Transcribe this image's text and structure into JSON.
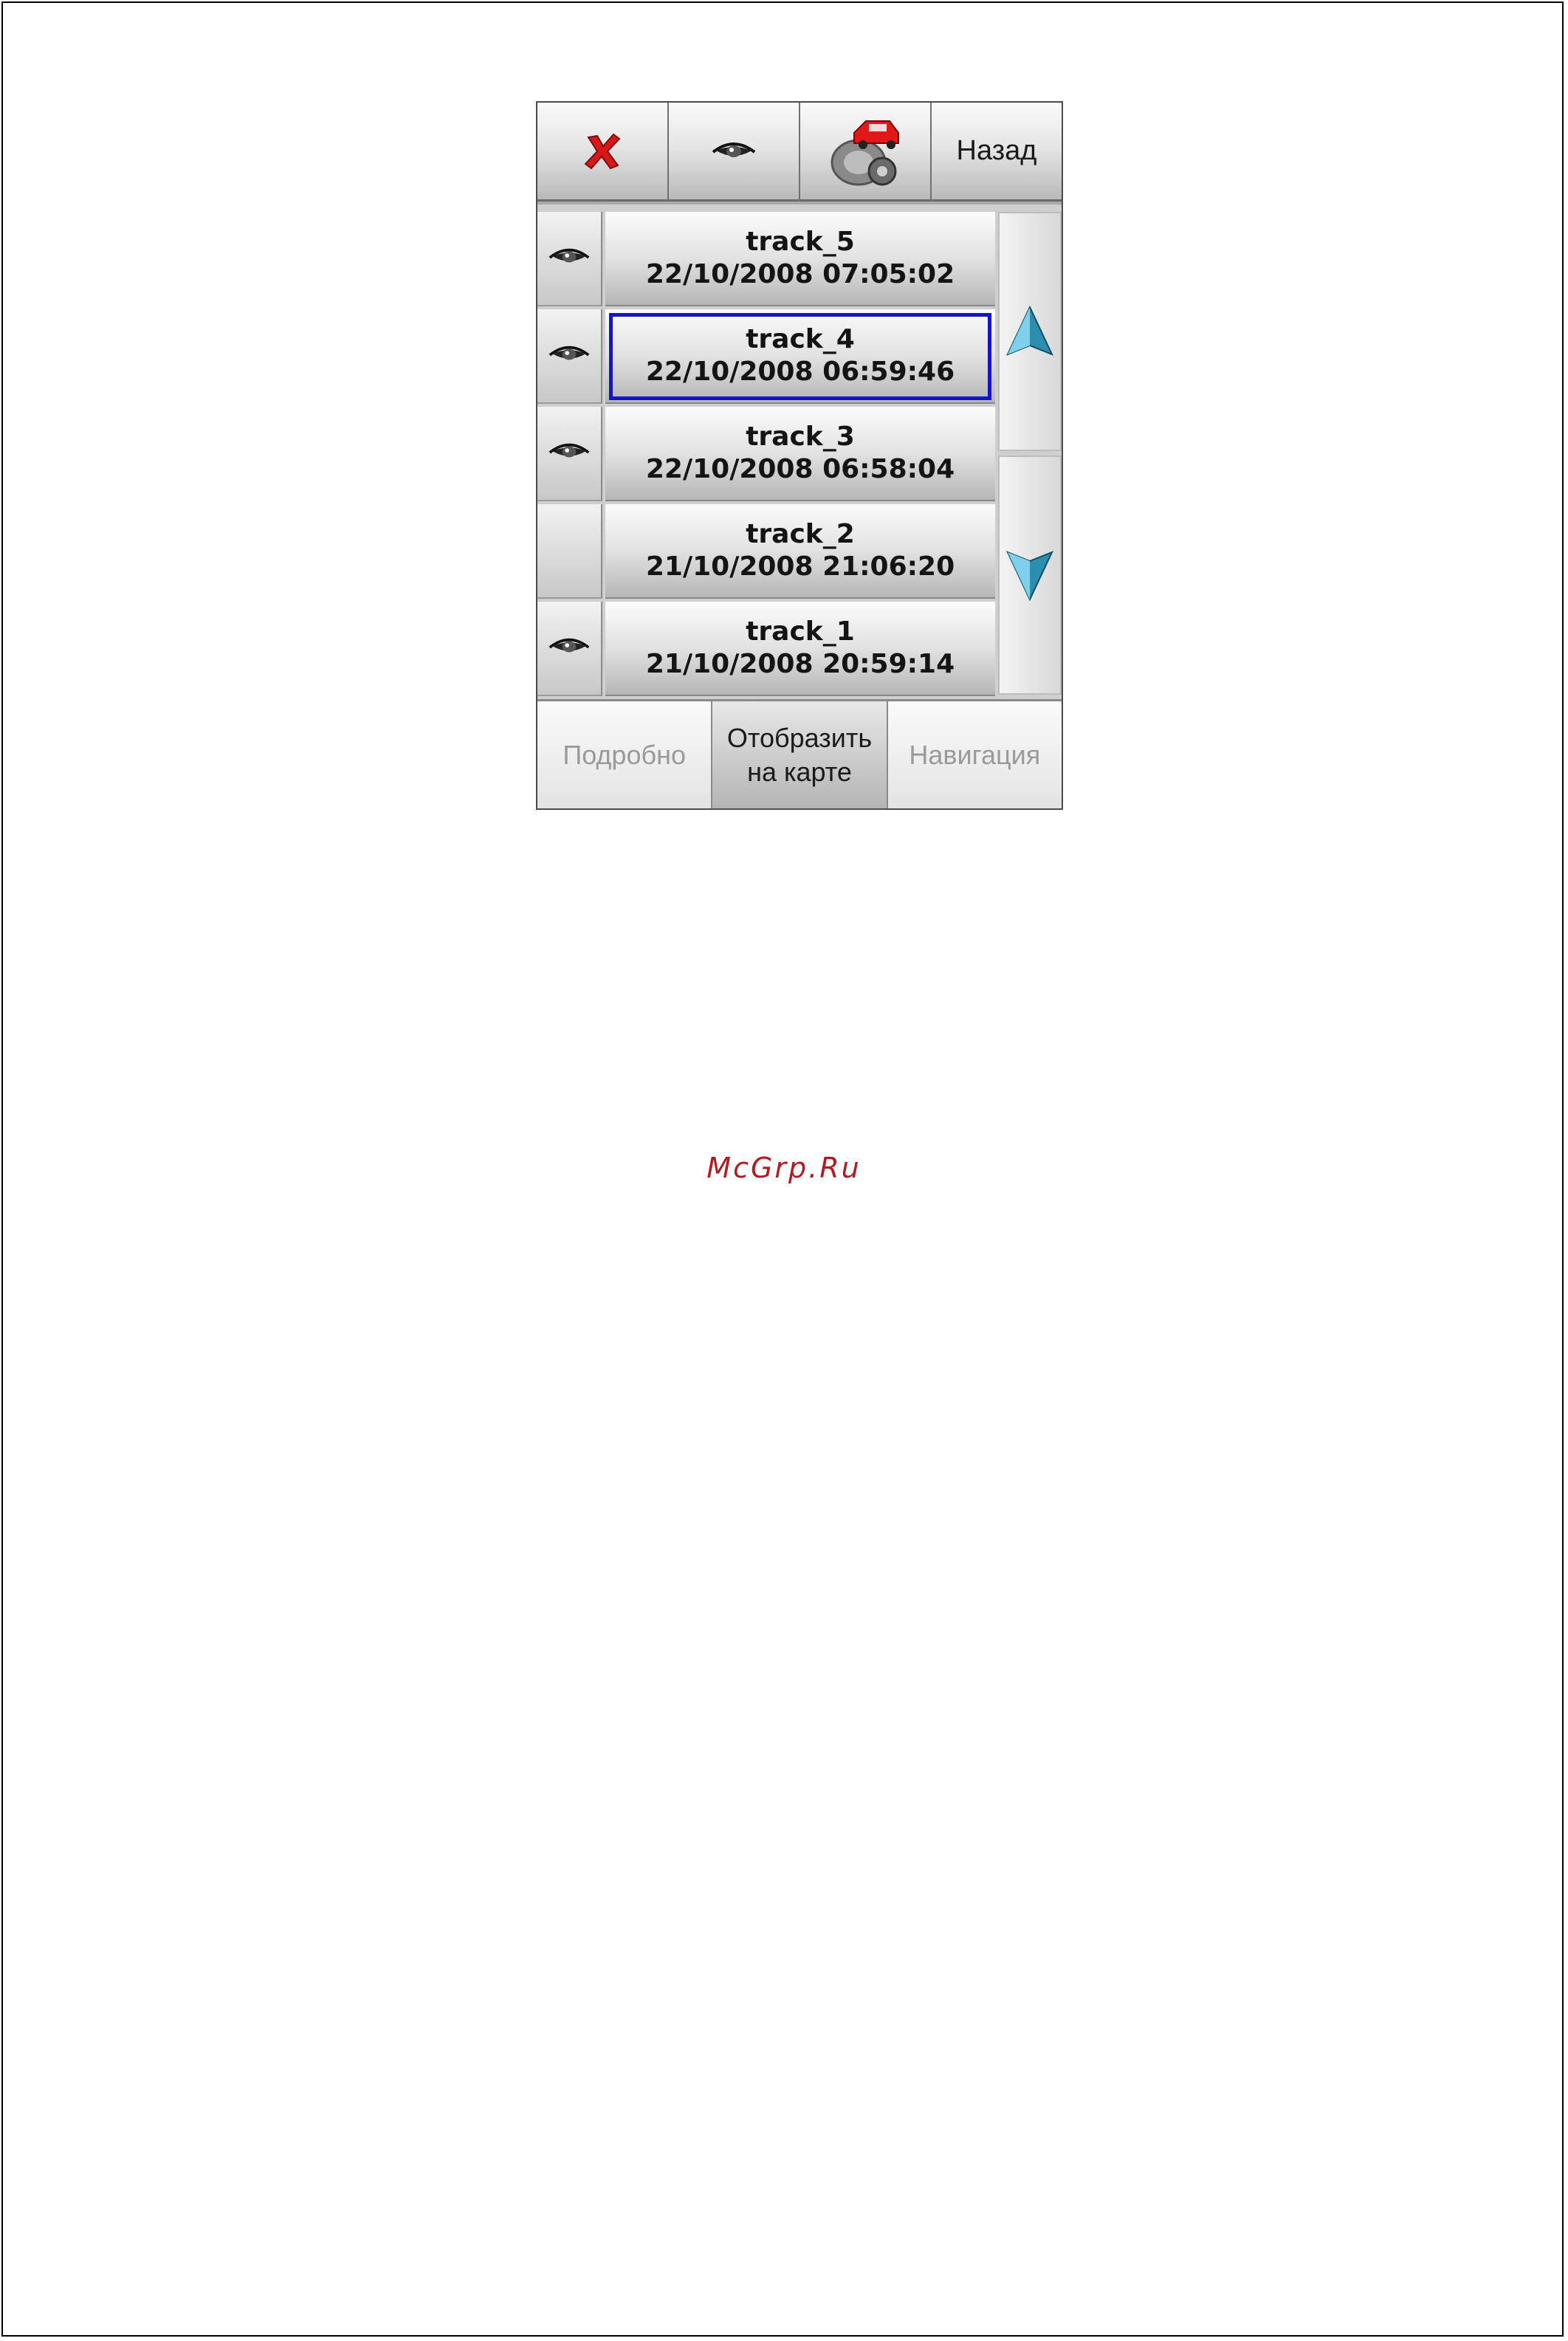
{
  "toolbar": {
    "delete_icon": "red-x-icon",
    "view_icon": "eye-icon",
    "settings_icon": "car-gear-icon",
    "back_label": "Назад"
  },
  "tracks": [
    {
      "name": "track_5",
      "datetime": "22/10/2008 07:05:02",
      "visible": true,
      "selected": false
    },
    {
      "name": "track_4",
      "datetime": "22/10/2008 06:59:46",
      "visible": true,
      "selected": true
    },
    {
      "name": "track_3",
      "datetime": "22/10/2008 06:58:04",
      "visible": true,
      "selected": false
    },
    {
      "name": "track_2",
      "datetime": "21/10/2008 21:06:20",
      "visible": false,
      "selected": false
    },
    {
      "name": "track_1",
      "datetime": "21/10/2008 20:59:14",
      "visible": true,
      "selected": false
    }
  ],
  "scroll": {
    "up_icon": "arrow-up-icon",
    "down_icon": "arrow-down-icon"
  },
  "bottom": {
    "details_label": "Подробно",
    "show_on_map_label": "Отобразить\nна карте",
    "navigation_label": "Навигация"
  },
  "watermark": "McGrp.Ru",
  "colors": {
    "selection": "#1515c8",
    "delete": "#d81818",
    "scroll_arrow": "#2c8fb0",
    "watermark": "#b01c22"
  }
}
